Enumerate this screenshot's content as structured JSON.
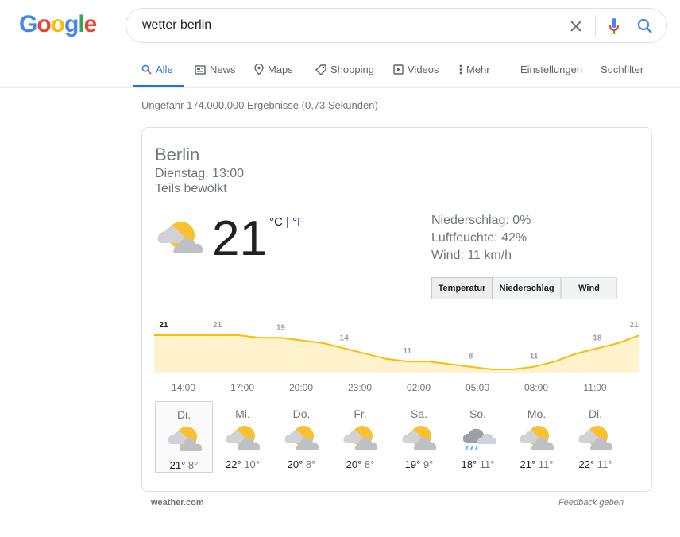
{
  "logo": {
    "letters": [
      "G",
      "o",
      "o",
      "g",
      "l",
      "e"
    ],
    "colors": [
      "#4285F4",
      "#EA4335",
      "#FBBC05",
      "#4285F4",
      "#34A853",
      "#EA4335"
    ]
  },
  "search": {
    "query": "wetter berlin",
    "icons": [
      "close-icon",
      "mic-icon",
      "search-icon"
    ]
  },
  "tabs": [
    {
      "label": "Alle",
      "icon": "search-icon",
      "active": true
    },
    {
      "label": "News",
      "icon": "news-icon"
    },
    {
      "label": "Maps",
      "icon": "pin-icon"
    },
    {
      "label": "Shopping",
      "icon": "tag-icon"
    },
    {
      "label": "Videos",
      "icon": "play-icon"
    },
    {
      "label": "Mehr",
      "icon": "more-icon"
    },
    {
      "label": "Einstellungen"
    },
    {
      "label": "Suchfilter"
    }
  ],
  "result_stats": "Ungefähr 174.000.000 Ergebnisse (0,73 Sekunden)",
  "weather": {
    "location": "Berlin",
    "datetime": "Dienstag, 13:00",
    "condition": "Teils bewölkt",
    "temperature": "21",
    "unit_c": "°C",
    "unit_sep": " | ",
    "unit_f": "°F",
    "details": [
      "Niederschlag: 0%",
      "Luftfeuchte: 42%",
      "Wind: 11 km/h"
    ],
    "buttons": [
      "Temperatur",
      "Niederschlag",
      "Wind"
    ],
    "selected_button": "Temperatur",
    "source": "weather.com",
    "feedback": "Feedback geben"
  },
  "chart_data": {
    "type": "area",
    "x": [
      "13:00",
      "14:00",
      "15:00",
      "16:00",
      "17:00",
      "18:00",
      "19:00",
      "20:00",
      "21:00",
      "22:00",
      "23:00",
      "00:00",
      "01:00",
      "02:00",
      "03:00",
      "04:00",
      "05:00",
      "06:00",
      "07:00",
      "08:00",
      "09:00",
      "10:00",
      "11:00",
      "12:00"
    ],
    "values": [
      21,
      21,
      21,
      21,
      21,
      20,
      20,
      19,
      18,
      16,
      14,
      12,
      11,
      11,
      10,
      9,
      8,
      8,
      9,
      11,
      14,
      16,
      18,
      21
    ],
    "point_labels": [
      {
        "index": 0,
        "value": "21",
        "bold": true
      },
      {
        "index": 3,
        "value": "21"
      },
      {
        "index": 6,
        "value": "19"
      },
      {
        "index": 9,
        "value": "14"
      },
      {
        "index": 12,
        "value": "11"
      },
      {
        "index": 15,
        "value": "8"
      },
      {
        "index": 18,
        "value": "11"
      },
      {
        "index": 21,
        "value": "18"
      },
      {
        "index": 23,
        "value": "21"
      }
    ],
    "tick_labels": [
      "14:00",
      "17:00",
      "20:00",
      "23:00",
      "02:00",
      "05:00",
      "08:00",
      "11:00"
    ],
    "series_color": "#fbbc04",
    "fill_color": "#fff3cd",
    "ylim": [
      0,
      23
    ]
  },
  "forecast": [
    {
      "day": "Di.",
      "hi": "21°",
      "lo": "8°",
      "icon": "partly-cloudy-icon",
      "selected": true
    },
    {
      "day": "Mi.",
      "hi": "22°",
      "lo": "10°",
      "icon": "partly-cloudy-icon"
    },
    {
      "day": "Do.",
      "hi": "20°",
      "lo": "8°",
      "icon": "partly-cloudy-icon"
    },
    {
      "day": "Fr.",
      "hi": "20°",
      "lo": "8°",
      "icon": "partly-cloudy-icon"
    },
    {
      "day": "Sa.",
      "hi": "19°",
      "lo": "9°",
      "icon": "partly-cloudy-icon"
    },
    {
      "day": "So.",
      "hi": "18°",
      "lo": "11°",
      "icon": "rain-icon"
    },
    {
      "day": "Mo.",
      "hi": "21°",
      "lo": "11°",
      "icon": "partly-cloudy-icon"
    },
    {
      "day": "Di.",
      "hi": "22°",
      "lo": "11°",
      "icon": "partly-cloudy-icon"
    }
  ]
}
